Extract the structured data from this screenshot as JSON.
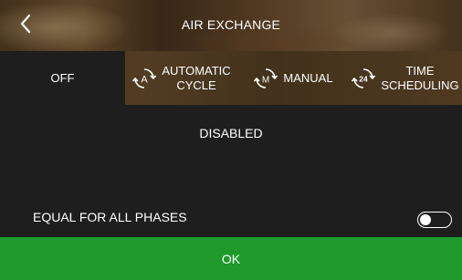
{
  "header": {
    "title": "AIR EXCHANGE",
    "back_icon": "chevron-left-icon"
  },
  "tabs": [
    {
      "id": "off",
      "label": "OFF",
      "icon": null,
      "selected": true
    },
    {
      "id": "automatic",
      "label_line1": "AUTOMATIC",
      "label_line2": "CYCLE",
      "icon": "auto-cycle-icon",
      "icon_glyph": "A",
      "selected": false
    },
    {
      "id": "manual",
      "label": "MANUAL",
      "icon": "manual-cycle-icon",
      "icon_glyph": "M",
      "selected": false
    },
    {
      "id": "time",
      "label_line1": "TIME",
      "label_line2": "SCHEDULING",
      "icon": "schedule-24-icon",
      "icon_glyph": "24",
      "selected": false
    }
  ],
  "main": {
    "status": "DISABLED",
    "phases_label": "EQUAL FOR ALL PHASES",
    "phases_toggle_on": false
  },
  "footer": {
    "ok_label": "OK"
  },
  "colors": {
    "background": "#1e1e1e",
    "ok_green": "#1e9a2b",
    "text": "#ffffff"
  }
}
